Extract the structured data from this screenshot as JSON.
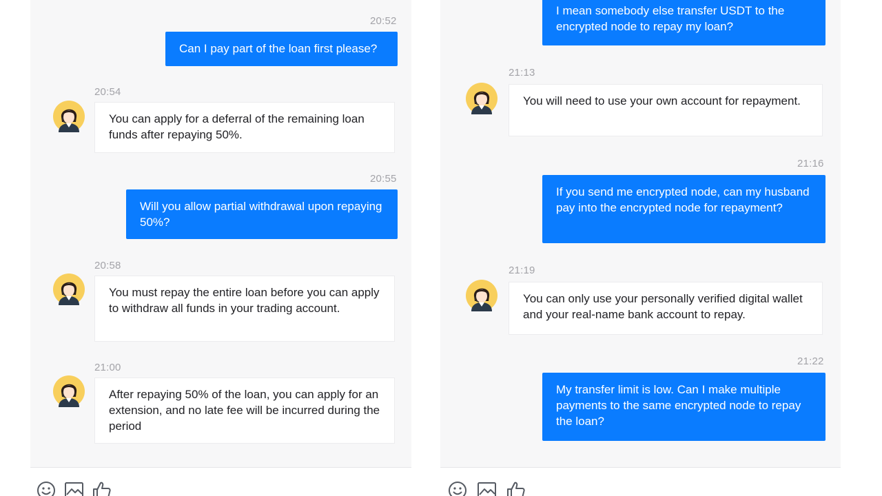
{
  "left": {
    "messages": [
      {
        "time": "20:52",
        "text": "Can I pay part of the loan first please?"
      },
      {
        "time": "20:54",
        "text": "You can apply for a deferral of the remaining loan funds after repaying 50%."
      },
      {
        "time": "20:55",
        "text": "Will you allow partial withdrawal upon repaying 50%?"
      },
      {
        "time": "20:58",
        "text": "You must repay the entire loan before you can apply to withdraw all funds in your trading account."
      },
      {
        "time": "21:00",
        "text": "After repaying 50% of the loan, you can apply for an extension, and no late fee will be incurred during the period"
      }
    ]
  },
  "right": {
    "messages": [
      {
        "time": "",
        "text": "I mean somebody else transfer USDT to the encrypted node to repay my loan?"
      },
      {
        "time": "21:13",
        "text": "You will need to use your own account for repayment."
      },
      {
        "time": "21:16",
        "text": "If you send me encrypted node, can my husband pay into the encrypted node for repayment?"
      },
      {
        "time": "21:19",
        "text": "You can only use your personally verified digital wallet and your real-name bank account to repay."
      },
      {
        "time": "21:22",
        "text": "My transfer limit is low. Can I make multiple payments to the same encrypted node to repay the loan?"
      }
    ]
  },
  "toolbar": {
    "icons": [
      "emoji-icon",
      "image-icon",
      "thumbs-up-icon"
    ]
  },
  "colors": {
    "outgoing_bubble": "#0a7cff",
    "incoming_bubble": "#ffffff",
    "timestamp": "#a3a3a8",
    "panel_background": "#f7f7f8"
  }
}
